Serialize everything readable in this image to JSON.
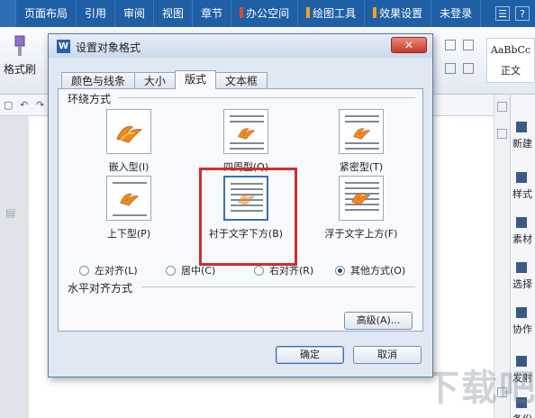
{
  "menubar": {
    "items": [
      "页面布局",
      "引用",
      "审阅",
      "视图",
      "章节",
      "办公空间",
      "绘图工具",
      "效果设置",
      "未登录"
    ]
  },
  "ribbon": {
    "format_brush": "格式刷",
    "style_preview": "AaBbCc",
    "style_name": "正文"
  },
  "sidebar": {
    "items": [
      "新建",
      "样式",
      "素材",
      "选择",
      "协作",
      "发射",
      "备份"
    ]
  },
  "watermark": "下载吧",
  "dialog": {
    "app_icon": "W",
    "title": "设置对象格式",
    "close": "✕",
    "tabs": [
      "颜色与线条",
      "大小",
      "版式",
      "文本框"
    ],
    "active_tab": "版式",
    "wrap_section_label": "环绕方式",
    "wrap_options": [
      {
        "label": "嵌入型(I)"
      },
      {
        "label": "四周型(Q)"
      },
      {
        "label": "紧密型(T)"
      },
      {
        "label": "上下型(P)"
      },
      {
        "label": "衬于文字下方(B)"
      },
      {
        "label": "浮于文字上方(F)"
      }
    ],
    "selected_wrap": "衬于文字下方(B)",
    "align_section_label": "水平对齐方式",
    "align_options": [
      {
        "label": "左对齐(L)",
        "checked": false
      },
      {
        "label": "居中(C)",
        "checked": false
      },
      {
        "label": "右对齐(R)",
        "checked": false
      },
      {
        "label": "其他方式(O)",
        "checked": true
      }
    ],
    "advanced_button": "高级(A)...",
    "ok_button": "确定",
    "cancel_button": "取消"
  },
  "colors": {
    "menubar_bg": "#1f5fa6",
    "highlight_border": "#d62b2b",
    "dialog_bg": "#dfe8f3"
  }
}
